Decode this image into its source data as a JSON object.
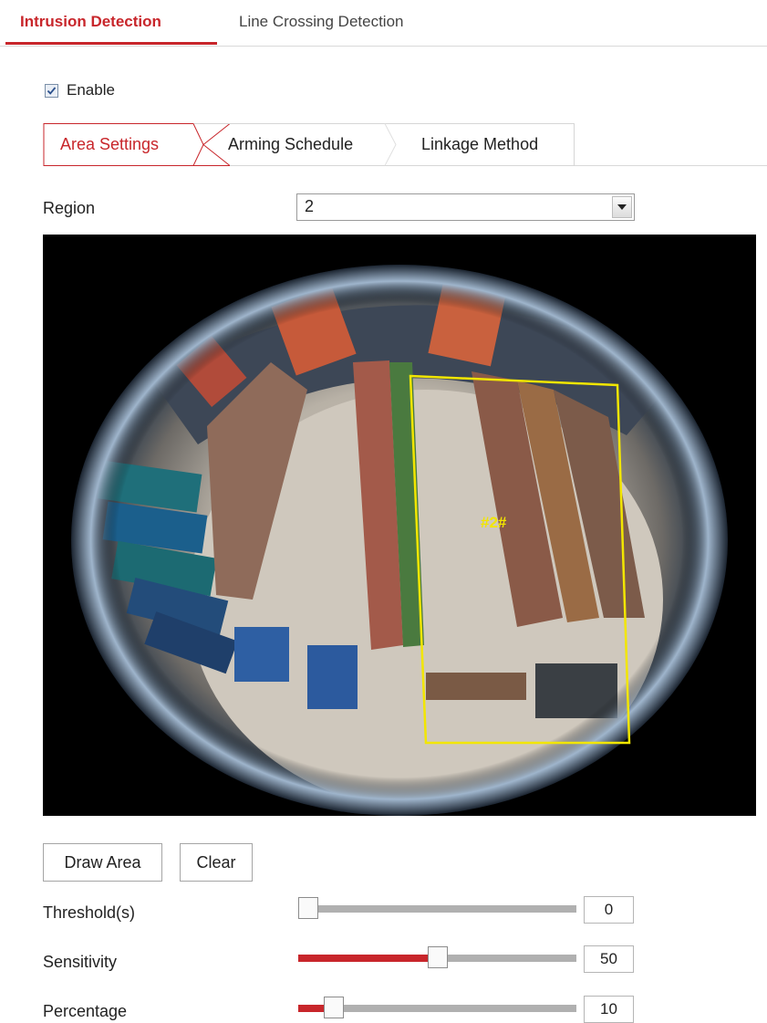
{
  "top_tabs": [
    {
      "label": "Intrusion Detection",
      "active": true
    },
    {
      "label": "Line Crossing Detection",
      "active": false
    }
  ],
  "enable": {
    "label": "Enable",
    "checked": true
  },
  "sub_tabs": [
    {
      "label": "Area Settings",
      "active": true
    },
    {
      "label": "Arming Schedule",
      "active": false
    },
    {
      "label": "Linkage Method",
      "active": false
    }
  ],
  "region": {
    "label": "Region",
    "value": "2"
  },
  "video": {
    "region_tag": "#2#",
    "region_color": "#f2e600"
  },
  "buttons": {
    "draw_area": "Draw Area",
    "clear": "Clear"
  },
  "sliders": [
    {
      "label": "Threshold(s)",
      "value": "0",
      "fraction": 0.0
    },
    {
      "label": "Sensitivity",
      "value": "50",
      "fraction": 0.5
    },
    {
      "label": "Percentage",
      "value": "10",
      "fraction": 0.1
    }
  ],
  "colors": {
    "accent": "#c8262b",
    "track": "#b0b0b0"
  }
}
